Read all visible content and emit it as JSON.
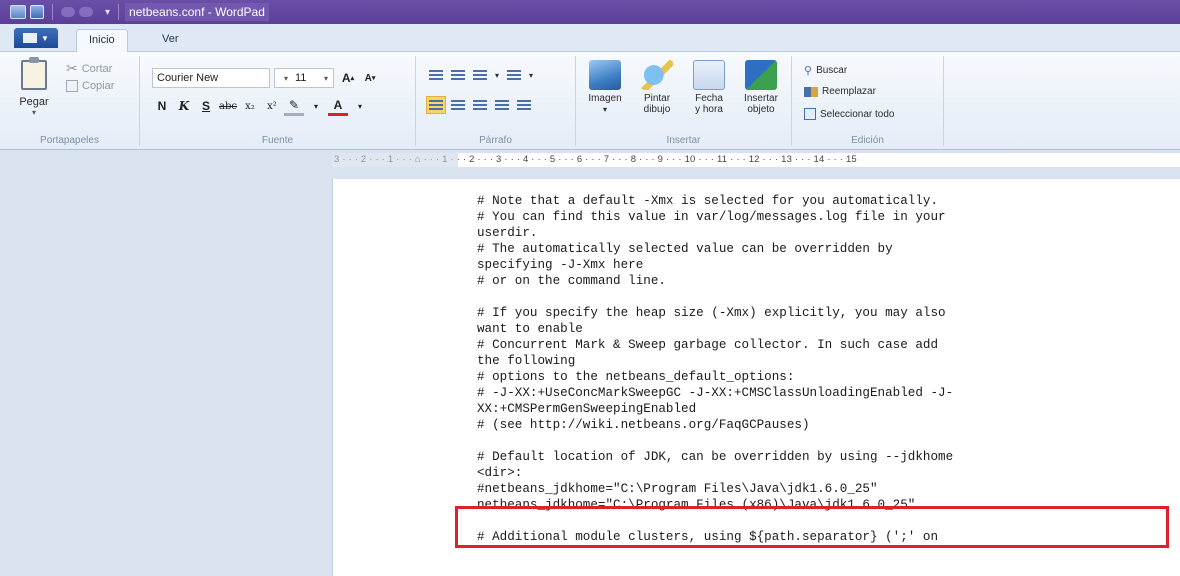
{
  "window": {
    "title": "netbeans.conf - WordPad"
  },
  "tabs": [
    {
      "label": "Inicio"
    },
    {
      "label": "Ver"
    }
  ],
  "ribbon": {
    "clipboard": {
      "paste": "Pegar",
      "cut": "Cortar",
      "copy": "Copiar",
      "group": "Portapapeles"
    },
    "font": {
      "family": "Courier New",
      "size": "11",
      "group": "Fuente"
    },
    "paragraph": {
      "group": "Párrafo"
    },
    "insert": {
      "image": "Imagen",
      "paint1": "Pintar",
      "paint2": "dibujo",
      "date1": "Fecha",
      "date2": "y hora",
      "obj1": "Insertar",
      "obj2": "objeto",
      "group": "Insertar"
    },
    "edit": {
      "find": "Buscar",
      "replace": "Reemplazar",
      "select_all": "Seleccionar todo",
      "group": "Edición"
    }
  },
  "ruler": {
    "text": "3 · · · 2 · · · 1 · · · ⌂ · · · 1 · · · 2 · · · 3 · · · 4 · · · 5 · · · 6 · · · 7 · · · 8 · · · 9 · · · 10 · · · 11 · · · 12 · · · 13 · · · 14 · · · 15"
  },
  "document": {
    "lines": [
      "# Note that a default -Xmx is selected for you automatically.",
      "# You can find this value in var/log/messages.log file in your",
      "userdir.",
      "# The automatically selected value can be overridden by",
      "specifying -J-Xmx here",
      "# or on the command line.",
      "",
      "# If you specify the heap size (-Xmx) explicitly, you may also",
      "want to enable",
      "# Concurrent Mark & Sweep garbage collector. In such case add",
      "the following",
      "# options to the netbeans_default_options:",
      "# -J-XX:+UseConcMarkSweepGC -J-XX:+CMSClassUnloadingEnabled -J-",
      "XX:+CMSPermGenSweepingEnabled",
      "# (see http://wiki.netbeans.org/FaqGCPauses)",
      "",
      "# Default location of JDK, can be overridden by using --jdkhome",
      "<dir>:",
      "#netbeans_jdkhome=\"C:\\Program Files\\Java\\jdk1.6.0_25\"",
      "netbeans_jdkhome=\"C:\\Program Files (x86)\\Java\\jdk1.6.0_25\"",
      "",
      "# Additional module clusters, using ${path.separator} (';' on"
    ]
  },
  "colors": {
    "titlebar": "#5b3f98",
    "highlight_border": "#e0202a",
    "canvas": "#d9e3f0"
  }
}
